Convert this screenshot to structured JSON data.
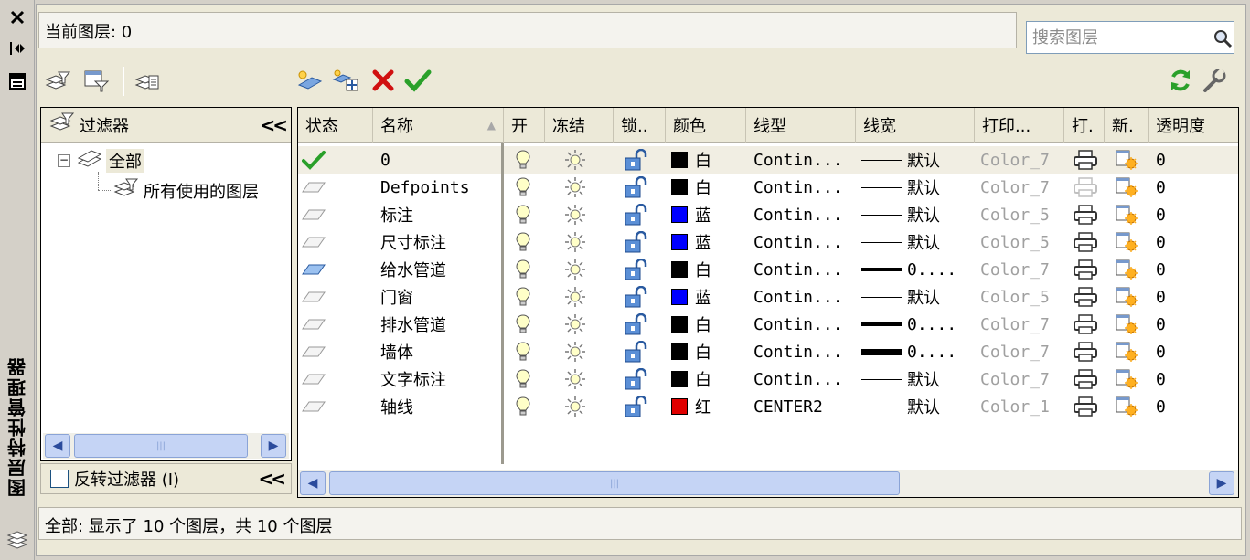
{
  "sidebar": {
    "title": "图层特性管理器"
  },
  "header": {
    "current_layer": "当前图层: 0",
    "search_placeholder": "搜索图层"
  },
  "filter_panel": {
    "title": "过滤器",
    "root": "全部",
    "child": "所有使用的图层",
    "invert_label": "反转过滤器 (I)"
  },
  "grid": {
    "columns": [
      "状态",
      "名称",
      "开",
      "冻结",
      "锁..",
      "颜色",
      "线型",
      "线宽",
      "打印...",
      "打.",
      "新.",
      "透明度"
    ],
    "rows": [
      {
        "name": "0",
        "color_hex": "#000000",
        "color_name": "白",
        "linetype": "Contin...",
        "lineweight": "默认",
        "lw": "thin",
        "plot_style": "Color_7",
        "status": "current",
        "plot_disabled": false,
        "transparency": "0"
      },
      {
        "name": "Defpoints",
        "color_hex": "#000000",
        "color_name": "白",
        "linetype": "Contin...",
        "lineweight": "默认",
        "lw": "thin",
        "plot_style": "Color_7",
        "status": "inactive",
        "plot_disabled": true,
        "transparency": "0"
      },
      {
        "name": "标注",
        "color_hex": "#0000ff",
        "color_name": "蓝",
        "linetype": "Contin...",
        "lineweight": "默认",
        "lw": "thin",
        "plot_style": "Color_5",
        "status": "inactive",
        "plot_disabled": false,
        "transparency": "0"
      },
      {
        "name": "尺寸标注",
        "color_hex": "#0000ff",
        "color_name": "蓝",
        "linetype": "Contin...",
        "lineweight": "默认",
        "lw": "thin",
        "plot_style": "Color_5",
        "status": "inactive",
        "plot_disabled": false,
        "transparency": "0"
      },
      {
        "name": "给水管道",
        "color_hex": "#000000",
        "color_name": "白",
        "linetype": "Contin...",
        "lineweight": "0....",
        "lw": "medium",
        "plot_style": "Color_7",
        "status": "active",
        "plot_disabled": false,
        "transparency": "0"
      },
      {
        "name": "门窗",
        "color_hex": "#0000ff",
        "color_name": "蓝",
        "linetype": "Contin...",
        "lineweight": "默认",
        "lw": "thin",
        "plot_style": "Color_5",
        "status": "inactive",
        "plot_disabled": false,
        "transparency": "0"
      },
      {
        "name": "排水管道",
        "color_hex": "#000000",
        "color_name": "白",
        "linetype": "Contin...",
        "lineweight": "0....",
        "lw": "medium",
        "plot_style": "Color_7",
        "status": "inactive",
        "plot_disabled": false,
        "transparency": "0"
      },
      {
        "name": "墙体",
        "color_hex": "#000000",
        "color_name": "白",
        "linetype": "Contin...",
        "lineweight": "0....",
        "lw": "thick",
        "plot_style": "Color_7",
        "status": "inactive",
        "plot_disabled": false,
        "transparency": "0"
      },
      {
        "name": "文字标注",
        "color_hex": "#000000",
        "color_name": "白",
        "linetype": "Contin...",
        "lineweight": "默认",
        "lw": "thin",
        "plot_style": "Color_7",
        "status": "inactive",
        "plot_disabled": false,
        "transparency": "0"
      },
      {
        "name": "轴线",
        "color_hex": "#e00000",
        "color_name": "红",
        "linetype": "CENTER2",
        "lineweight": "默认",
        "lw": "thin",
        "plot_style": "Color_1",
        "status": "inactive",
        "plot_disabled": false,
        "transparency": "0"
      }
    ]
  },
  "status_bar": {
    "text": "全部: 显示了 10 个图层，共 10 个图层"
  },
  "colors": {
    "accent_green": "#2aa02a",
    "delete_red": "#d01010",
    "selection": "#f1eee3"
  },
  "icons": [
    "close-icon",
    "auto-hide-icon",
    "properties-icon",
    "new-property-filter-icon",
    "new-group-filter-icon",
    "layer-state-manager-icon",
    "new-layer-icon",
    "new-layer-vp-frozen-icon",
    "delete-layer-icon",
    "set-current-icon",
    "refresh-icon",
    "settings-icon",
    "search-icon",
    "lightbulb-icon",
    "sun-icon",
    "unlock-icon",
    "printer-icon",
    "new-vp-freeze-icon",
    "layer-stack-icon"
  ]
}
